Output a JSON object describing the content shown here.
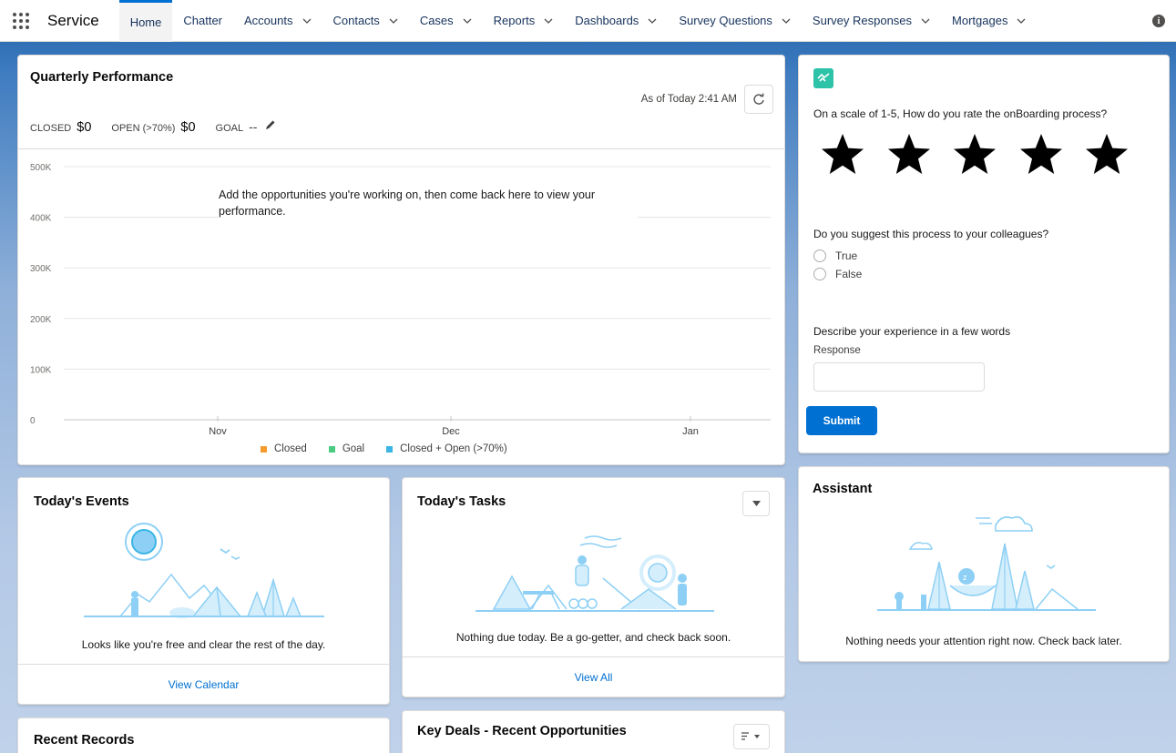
{
  "app": {
    "name": "Service"
  },
  "nav": {
    "items": [
      {
        "label": "Home",
        "active": true,
        "dropdown": false
      },
      {
        "label": "Chatter",
        "active": false,
        "dropdown": false
      },
      {
        "label": "Accounts",
        "active": false,
        "dropdown": true
      },
      {
        "label": "Contacts",
        "active": false,
        "dropdown": true
      },
      {
        "label": "Cases",
        "active": false,
        "dropdown": true
      },
      {
        "label": "Reports",
        "active": false,
        "dropdown": true
      },
      {
        "label": "Dashboards",
        "active": false,
        "dropdown": true
      },
      {
        "label": "Survey Questions",
        "active": false,
        "dropdown": true
      },
      {
        "label": "Survey Responses",
        "active": false,
        "dropdown": true
      },
      {
        "label": "Mortgages",
        "active": false,
        "dropdown": true
      }
    ]
  },
  "quarterly": {
    "title": "Quarterly Performance",
    "as_of": "As of Today 2:41 AM",
    "closed_label": "CLOSED",
    "closed_value": "$0",
    "open_label": "OPEN (>70%)",
    "open_value": "$0",
    "goal_label": "GOAL",
    "goal_value": "--",
    "empty_message": "Add the opportunities you're working on, then come back here to view your performance."
  },
  "chart_data": {
    "type": "line",
    "categories": [
      "Nov",
      "Dec",
      "Jan"
    ],
    "y_ticks": [
      "0",
      "100K",
      "200K",
      "300K",
      "400K",
      "500K"
    ],
    "ylim": [
      0,
      500000
    ],
    "grid": true,
    "legend_position": "bottom",
    "series": [
      {
        "name": "Closed",
        "color": "#f59b2e",
        "values": []
      },
      {
        "name": "Goal",
        "color": "#4bca81",
        "values": []
      },
      {
        "name": "Closed + Open (>70%)",
        "color": "#3ab5e5",
        "values": []
      }
    ]
  },
  "survey": {
    "q1": "On a scale of 1-5, How do you rate the onBoarding process?",
    "rating_max": 5,
    "q2": "Do you suggest this process to your colleagues?",
    "option_true": "True",
    "option_false": "False",
    "q3": "Describe your experience in a few words",
    "response_label": "Response",
    "response_value": "",
    "submit_label": "Submit"
  },
  "events": {
    "title": "Today's Events",
    "message": "Looks like you're free and clear the rest of the day.",
    "footer": "View Calendar"
  },
  "tasks": {
    "title": "Today's Tasks",
    "message": "Nothing due today. Be a go-getter, and check back soon.",
    "footer": "View All"
  },
  "assistant": {
    "title": "Assistant",
    "message": "Nothing needs your attention right now. Check back later."
  },
  "recent": {
    "title": "Recent Records"
  },
  "deals": {
    "title": "Key Deals - Recent Opportunities"
  },
  "colors": {
    "brand": "#0070d2",
    "survey_icon": "#2dc3a8",
    "illustration": "#8ed0f5"
  }
}
